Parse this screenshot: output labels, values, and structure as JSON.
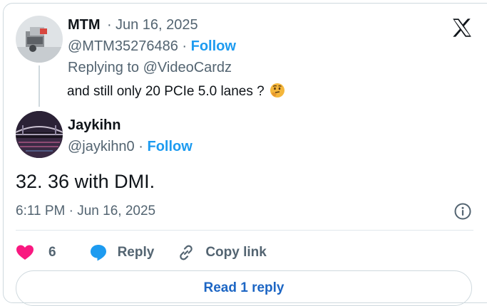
{
  "parent_tweet": {
    "author_name": "MTM",
    "dot": "·",
    "date": "Jun 16, 2025",
    "handle": "@MTM35276486",
    "follow_label": "Follow",
    "replying_to": "Replying to @VideoCardz",
    "text": "and still only 20 PCIe 5.0 lanes ?",
    "emoji": "thinking-face-emoji"
  },
  "main_tweet": {
    "author_name": "Jaykihn",
    "handle": "@jaykihn0",
    "follow_label": "Follow",
    "text": "32. 36 with DMI.",
    "timestamp": "6:11 PM · Jun 16, 2025"
  },
  "actions": {
    "like_count": "6",
    "reply_label": "Reply",
    "copy_link_label": "Copy link"
  },
  "read_replies_label": "Read 1 reply",
  "colors": {
    "accent": "#1d9bf0",
    "like": "#f91880",
    "muted": "#536471"
  }
}
